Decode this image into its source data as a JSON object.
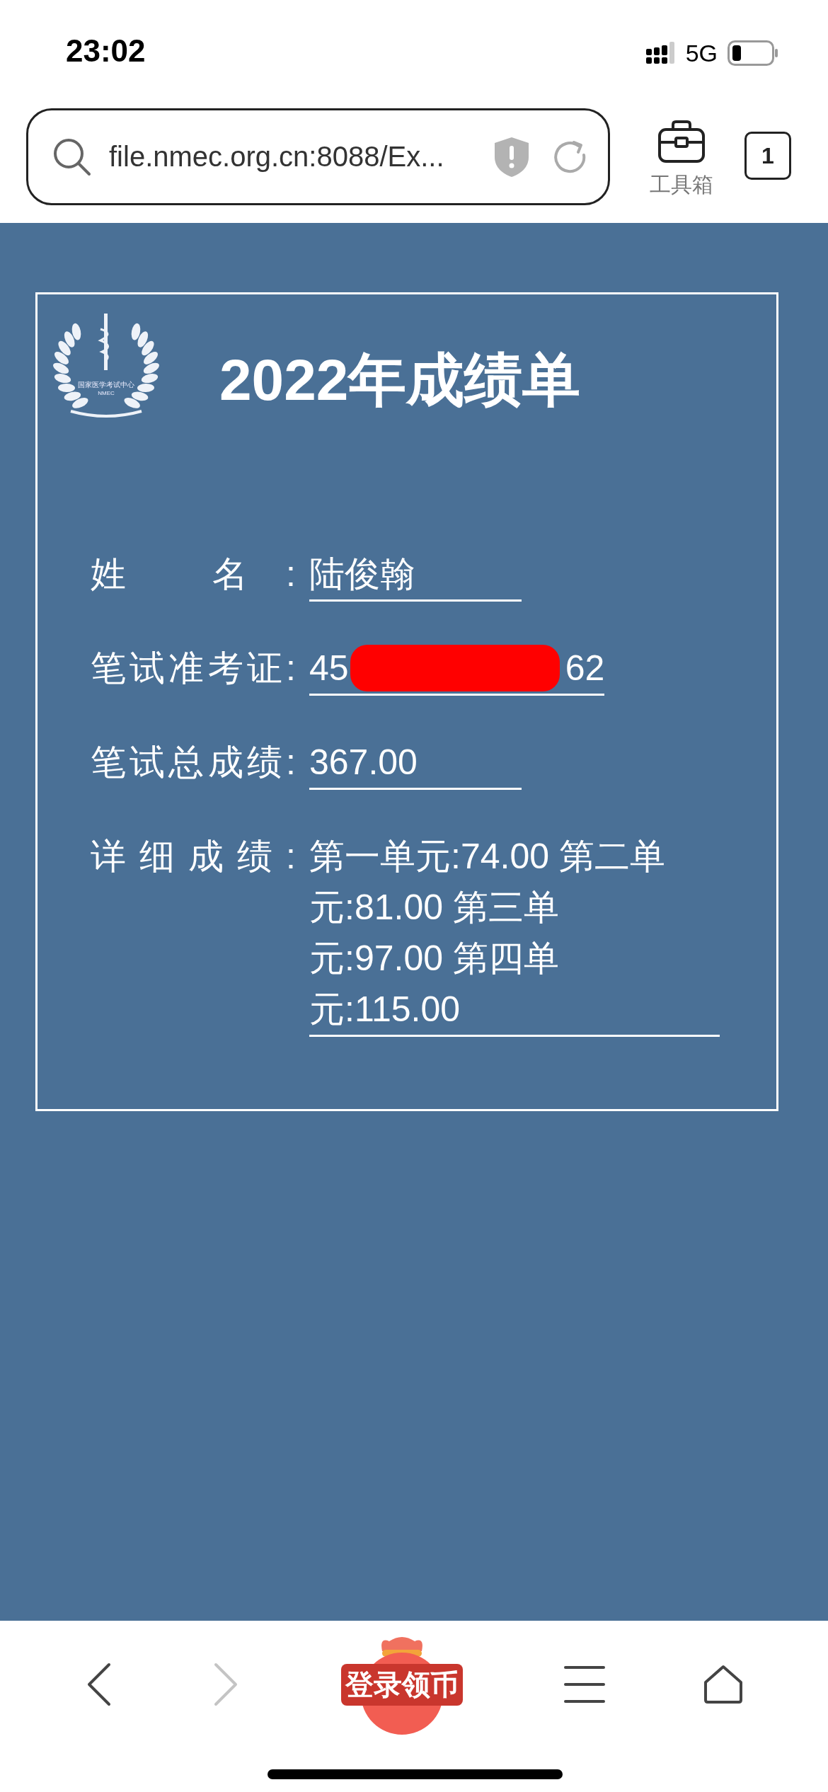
{
  "status_bar": {
    "time": "23:02",
    "network": "5G"
  },
  "address_bar": {
    "url": "file.nmec.org.cn:8088/Ex..."
  },
  "toolbar": {
    "toolbox_label": "工具箱",
    "tab_count": "1"
  },
  "report": {
    "logo_texts": [
      "国家医学考试中心",
      "NMEC"
    ],
    "title": "2022年成绩单",
    "fields": [
      {
        "label": "姓 名:",
        "value": "陆俊翰",
        "kind": "plain"
      },
      {
        "label": "笔试准考证:",
        "value": "45",
        "value_end": "62",
        "kind": "redacted"
      },
      {
        "label": "笔试总成绩:",
        "value": "367.00",
        "kind": "plain"
      },
      {
        "label": "详 细 成 绩 :",
        "value": "第一单元:74.00 第二单元:81.00 第三单元:97.00 第四单元:115.00",
        "kind": "multiline"
      }
    ]
  },
  "bottom_bar": {
    "promo": "登录领币",
    "forward_disabled": true
  }
}
